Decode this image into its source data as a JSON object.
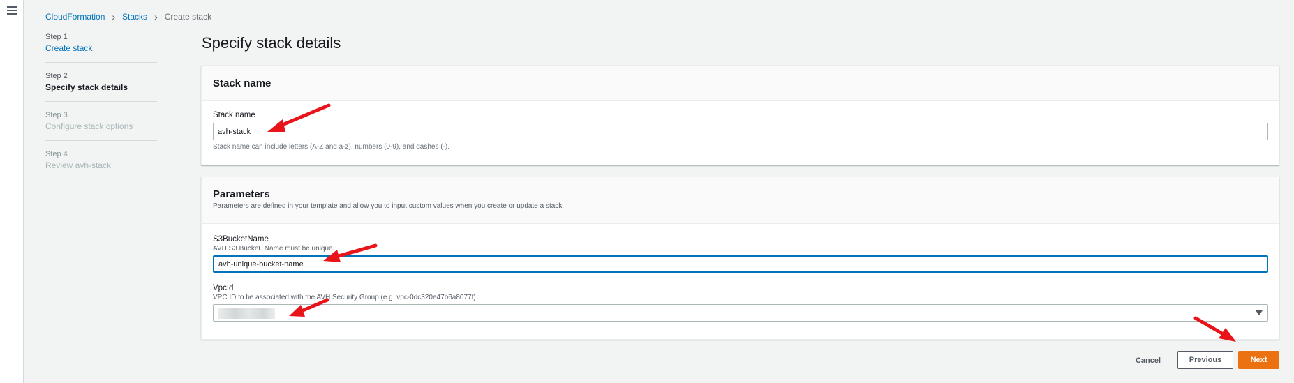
{
  "breadcrumb": {
    "items": [
      "CloudFormation",
      "Stacks"
    ],
    "current": "Create stack"
  },
  "steps": [
    {
      "num": "Step 1",
      "label": "Create stack",
      "state": "link"
    },
    {
      "num": "Step 2",
      "label": "Specify stack details",
      "state": "active"
    },
    {
      "num": "Step 3",
      "label": "Configure stack options",
      "state": "disabled"
    },
    {
      "num": "Step 4",
      "label": "Review avh-stack",
      "state": "disabled"
    }
  ],
  "page_title": "Specify stack details",
  "stack_name_panel": {
    "title": "Stack name",
    "field_label": "Stack name",
    "value": "avh-stack",
    "hint": "Stack name can include letters (A-Z and a-z), numbers (0-9), and dashes (-)."
  },
  "parameters_panel": {
    "title": "Parameters",
    "description": "Parameters are defined in your template and allow you to input custom values when you create or update a stack.",
    "bucket": {
      "label": "S3BucketName",
      "description": "AVH S3 Bucket. Name must be unique.",
      "value": "avh-unique-bucket-name"
    },
    "vpc": {
      "label": "VpcId",
      "description": "VPC ID to be associated with the AVH Security Group (e.g. vpc-0dc320e47b6a8077f)"
    }
  },
  "buttons": {
    "cancel": "Cancel",
    "previous": "Previous",
    "next": "Next"
  },
  "colors": {
    "accent": "#ec7211",
    "link": "#0073bb",
    "annotation_arrow": "#e8141a"
  }
}
